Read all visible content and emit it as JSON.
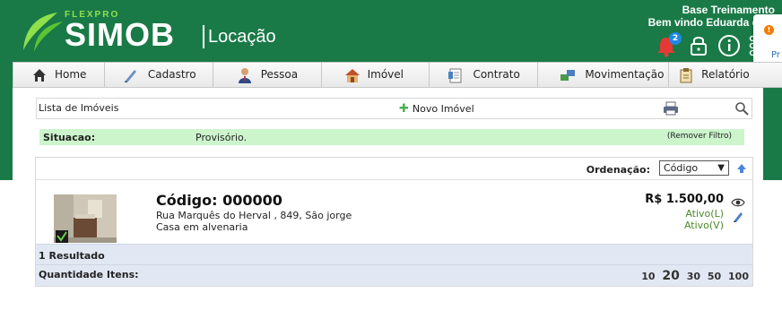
{
  "header": {
    "logo_small": "FLEXPRO",
    "logo_main": "SIMOB",
    "logo_sub": "Locação",
    "company": "Base Treinamento",
    "welcome": "Bem vindo Eduarda de S",
    "notification_count": "2",
    "icons": [
      "bell-icon",
      "lock-icon",
      "info-icon",
      "apps-icon"
    ]
  },
  "toast": {
    "text": "Pr",
    "icon": "info-icon",
    "color": "#f57c00"
  },
  "nav": {
    "items": [
      {
        "label": "Home",
        "icon": "home-icon"
      },
      {
        "label": "Cadastro",
        "icon": "pen-icon"
      },
      {
        "label": "Pessoa",
        "icon": "person-icon"
      },
      {
        "label": "Imóvel",
        "icon": "house-icon"
      },
      {
        "label": "Contrato",
        "icon": "document-icon"
      },
      {
        "label": "Movimentação",
        "icon": "transfer-icon"
      },
      {
        "label": "Relatório",
        "icon": "clipboard-icon"
      }
    ]
  },
  "toolbar": {
    "title": "Lista de Imóveis",
    "new_label": "Novo Imóvel"
  },
  "filter": {
    "label": "Situacao:",
    "value": "Provisório.",
    "remove_label": "(Remover Filtro)"
  },
  "ordering": {
    "label": "Ordenação:",
    "selected": "Código"
  },
  "item": {
    "code": "Código: 000000",
    "address": "Rua Marquês do Herval , 849, São jorge",
    "type": "Casa em alvenaria",
    "price": "R$ 1.500,00",
    "status_l": "Ativo(L)",
    "status_v": "Ativo(V)"
  },
  "footer": {
    "results": "1 Resultado",
    "quantity_label": "Quantidade Itens:",
    "page_sizes": [
      "10",
      "20",
      "30",
      "50",
      "100"
    ],
    "current_size": "20"
  },
  "colors": {
    "brand_green": "#1a7a47",
    "filter_bg": "#ccf5cc",
    "status_green": "#4a8a2a",
    "footer_bg": "#e2e8f3"
  }
}
